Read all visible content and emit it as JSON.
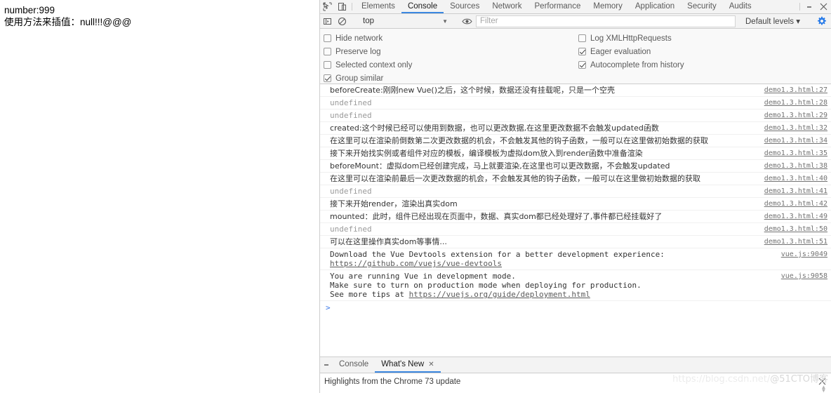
{
  "webpage": {
    "lines": [
      "number:999",
      "使用方法来插值：null!!!@@@"
    ]
  },
  "devtools": {
    "toolbar": {
      "inspect_icon": "inspect-cursor-icon",
      "device_icon": "device-toolbar-icon",
      "tabs": [
        {
          "label": "Elements",
          "active": false
        },
        {
          "label": "Console",
          "active": true
        },
        {
          "label": "Sources",
          "active": false
        },
        {
          "label": "Network",
          "active": false
        },
        {
          "label": "Performance",
          "active": false
        },
        {
          "label": "Memory",
          "active": false
        },
        {
          "label": "Application",
          "active": false
        },
        {
          "label": "Security",
          "active": false
        },
        {
          "label": "Audits",
          "active": false
        }
      ],
      "more_icon": "more-vertical-icon",
      "close_icon": "close-icon"
    },
    "filterbar": {
      "sidebar_icon": "show-console-sidebar-icon",
      "clear_icon": "clear-console-icon",
      "context_value": "top",
      "context_caret": "▼",
      "eye_icon": "live-expression-eye-icon",
      "filter_placeholder": "Filter",
      "filter_value": "",
      "levels_label": "Default levels ▾",
      "gear_icon": "settings-gear-icon",
      "gear_color": "#1a73e8"
    },
    "settings": {
      "left": [
        {
          "label": "Hide network",
          "checked": false
        },
        {
          "label": "Preserve log",
          "checked": false
        },
        {
          "label": "Selected context only",
          "checked": false
        },
        {
          "label": "Group similar",
          "checked": true
        }
      ],
      "right": [
        {
          "label": "Log XMLHttpRequests",
          "checked": false
        },
        {
          "label": "Eager evaluation",
          "checked": true
        },
        {
          "label": "Autocomplete from history",
          "checked": true
        }
      ]
    },
    "console": {
      "messages": [
        {
          "text": "beforeCreate:刚刚new Vue()之后，这个时候，数据还没有挂载呢，只是一个空壳",
          "source": "demo1.3.html:27",
          "kind": "cjk"
        },
        {
          "text": "undefined",
          "source": "demo1.3.html:28",
          "kind": "undefined"
        },
        {
          "text": "undefined",
          "source": "demo1.3.html:29",
          "kind": "undefined"
        },
        {
          "text": "created:这个时候已经可以使用到数据，也可以更改数据,在这里更改数据不会触发updated函数",
          "source": "demo1.3.html:32",
          "kind": "cjk"
        },
        {
          "text": "在这里可以在渲染前倒数第二次更改数据的机会，不会触发其他的钩子函数，一般可以在这里做初始数据的获取",
          "source": "demo1.3.html:34",
          "kind": "cjk"
        },
        {
          "text": "接下来开始找实例或者组件对应的模板，编译模板为虚拟dom放入到render函数中准备渲染",
          "source": "demo1.3.html:35",
          "kind": "cjk"
        },
        {
          "text": "beforeMount：虚拟dom已经创建完成，马上就要渲染,在这里也可以更改数据，不会触发updated",
          "source": "demo1.3.html:38",
          "kind": "cjk"
        },
        {
          "text": "在这里可以在渲染前最后一次更改数据的机会，不会触发其他的钩子函数，一般可以在这里做初始数据的获取",
          "source": "demo1.3.html:40",
          "kind": "cjk"
        },
        {
          "text": "undefined",
          "source": "demo1.3.html:41",
          "kind": "undefined"
        },
        {
          "text": "接下来开始render，渲染出真实dom",
          "source": "demo1.3.html:42",
          "kind": "cjk"
        },
        {
          "text": "mounted：此时，组件已经出现在页面中，数据、真实dom都已经处理好了,事件都已经挂载好了",
          "source": "demo1.3.html:49",
          "kind": "cjk"
        },
        {
          "text": "undefined",
          "source": "demo1.3.html:50",
          "kind": "undefined"
        },
        {
          "text": "可以在这里操作真实dom等事情...",
          "source": "demo1.3.html:51",
          "kind": "cjk"
        }
      ],
      "vue_devtools_notice": {
        "line1": "Download the Vue Devtools extension for a better development experience:",
        "link": "https://github.com/vuejs/vue-devtools",
        "source": "vue.js:9049"
      },
      "vue_dev_mode_notice": {
        "line1": "You are running Vue in development mode.",
        "line2": "Make sure to turn on production mode when deploying for production.",
        "line3_prefix": "See more tips at ",
        "link": "https://vuejs.org/guide/deployment.html",
        "source": "vue.js:9058"
      },
      "prompt_symbol": ">",
      "prompt_value": ""
    },
    "drawer": {
      "more_icon": "drawer-more-vertical-icon",
      "tabs": [
        {
          "label": "Console",
          "active": false,
          "closable": false
        },
        {
          "label": "What's New",
          "active": true,
          "closable": true,
          "close_glyph": "✕"
        }
      ],
      "body_text": "Highlights from the Chrome 73 update",
      "close_icon": "close-drawer-icon",
      "close_glyph": "✕"
    }
  },
  "watermark": {
    "url": "https://blog.csdn.net/",
    "handle": "@51CTO博客"
  }
}
